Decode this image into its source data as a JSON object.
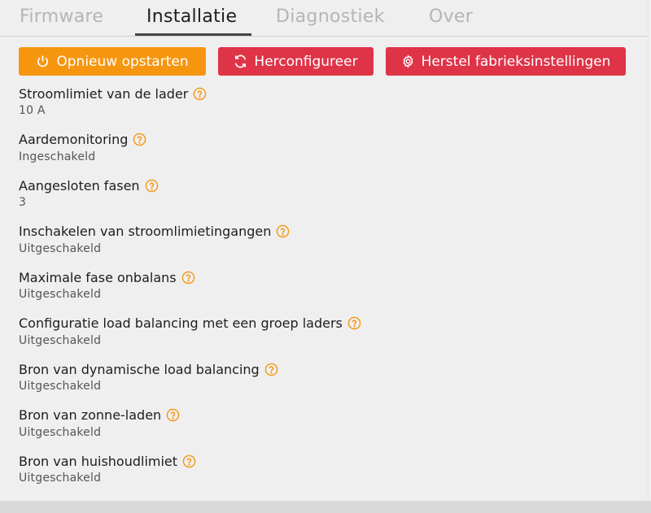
{
  "tabs": [
    {
      "label": "Firmware",
      "active": false
    },
    {
      "label": "Installatie",
      "active": true
    },
    {
      "label": "Diagnostiek",
      "active": false
    },
    {
      "label": "Over",
      "active": false
    }
  ],
  "actions": {
    "restart": {
      "label": "Opnieuw opstarten",
      "icon": "power-icon",
      "color": "#f6960f"
    },
    "reconfigure": {
      "label": "Herconfigureer",
      "icon": "refresh-icon",
      "color": "#df3347"
    },
    "factory_reset": {
      "label": "Herstel fabrieksinstellingen",
      "icon": "gear-icon",
      "color": "#df3347"
    }
  },
  "settings": [
    {
      "label": "Stroomlimiet van de lader",
      "value": "10 A"
    },
    {
      "label": "Aardemonitoring",
      "value": "Ingeschakeld"
    },
    {
      "label": "Aangesloten fasen",
      "value": "3"
    },
    {
      "label": "Inschakelen van stroomlimietingangen",
      "value": "Uitgeschakeld"
    },
    {
      "label": "Maximale fase onbalans",
      "value": "Uitgeschakeld"
    },
    {
      "label": "Configuratie load balancing met een groep laders",
      "value": "Uitgeschakeld"
    },
    {
      "label": "Bron van dynamische load balancing",
      "value": "Uitgeschakeld"
    },
    {
      "label": "Bron van zonne-laden",
      "value": "Uitgeschakeld"
    },
    {
      "label": "Bron van huishoudlimiet",
      "value": "Uitgeschakeld"
    }
  ],
  "help_icon_color": "#f6960f"
}
